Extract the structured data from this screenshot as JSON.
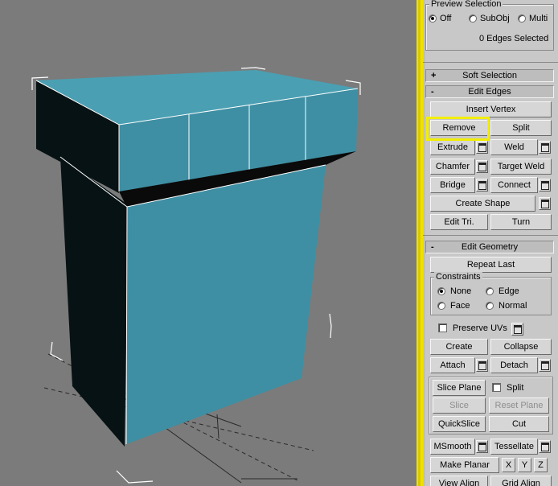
{
  "preview_selection": {
    "title": "Preview Selection",
    "options": [
      "Off",
      "SubObj",
      "Multi"
    ],
    "selected": "Off",
    "status": "0 Edges Selected"
  },
  "soft_selection": {
    "sign": "+",
    "title": "Soft Selection"
  },
  "edit_edges": {
    "sign": "-",
    "title": "Edit Edges",
    "insert_vertex": "Insert Vertex",
    "remove": "Remove",
    "split": "Split",
    "extrude": "Extrude",
    "weld": "Weld",
    "chamfer": "Chamfer",
    "target_weld": "Target Weld",
    "bridge": "Bridge",
    "connect": "Connect",
    "create_shape": "Create Shape",
    "edit_tri": "Edit Tri.",
    "turn": "Turn"
  },
  "edit_geometry": {
    "sign": "-",
    "title": "Edit Geometry",
    "repeat_last": "Repeat Last",
    "constraints": {
      "title": "Constraints",
      "options": [
        "None",
        "Edge",
        "Face",
        "Normal"
      ],
      "selected": "None"
    },
    "preserve_uvs": "Preserve UVs",
    "create": "Create",
    "collapse": "Collapse",
    "attach": "Attach",
    "detach": "Detach",
    "slice_plane": "Slice Plane",
    "split": "Split",
    "slice": "Slice",
    "reset_plane": "Reset Plane",
    "quickslice": "QuickSlice",
    "cut": "Cut",
    "msmooth": "MSmooth",
    "tessellate": "Tessellate",
    "make_planar": "Make Planar",
    "x": "X",
    "y": "Y",
    "z": "Z",
    "view_align": "View Align",
    "grid_align": "Grid Align"
  },
  "colors": {
    "viewport_bg": "#7b7b7b",
    "mesh_face": "#3e8fa3",
    "mesh_top": "#4a9fb2",
    "mesh_shadow": "#071214",
    "highlight": "#f2ee00"
  }
}
